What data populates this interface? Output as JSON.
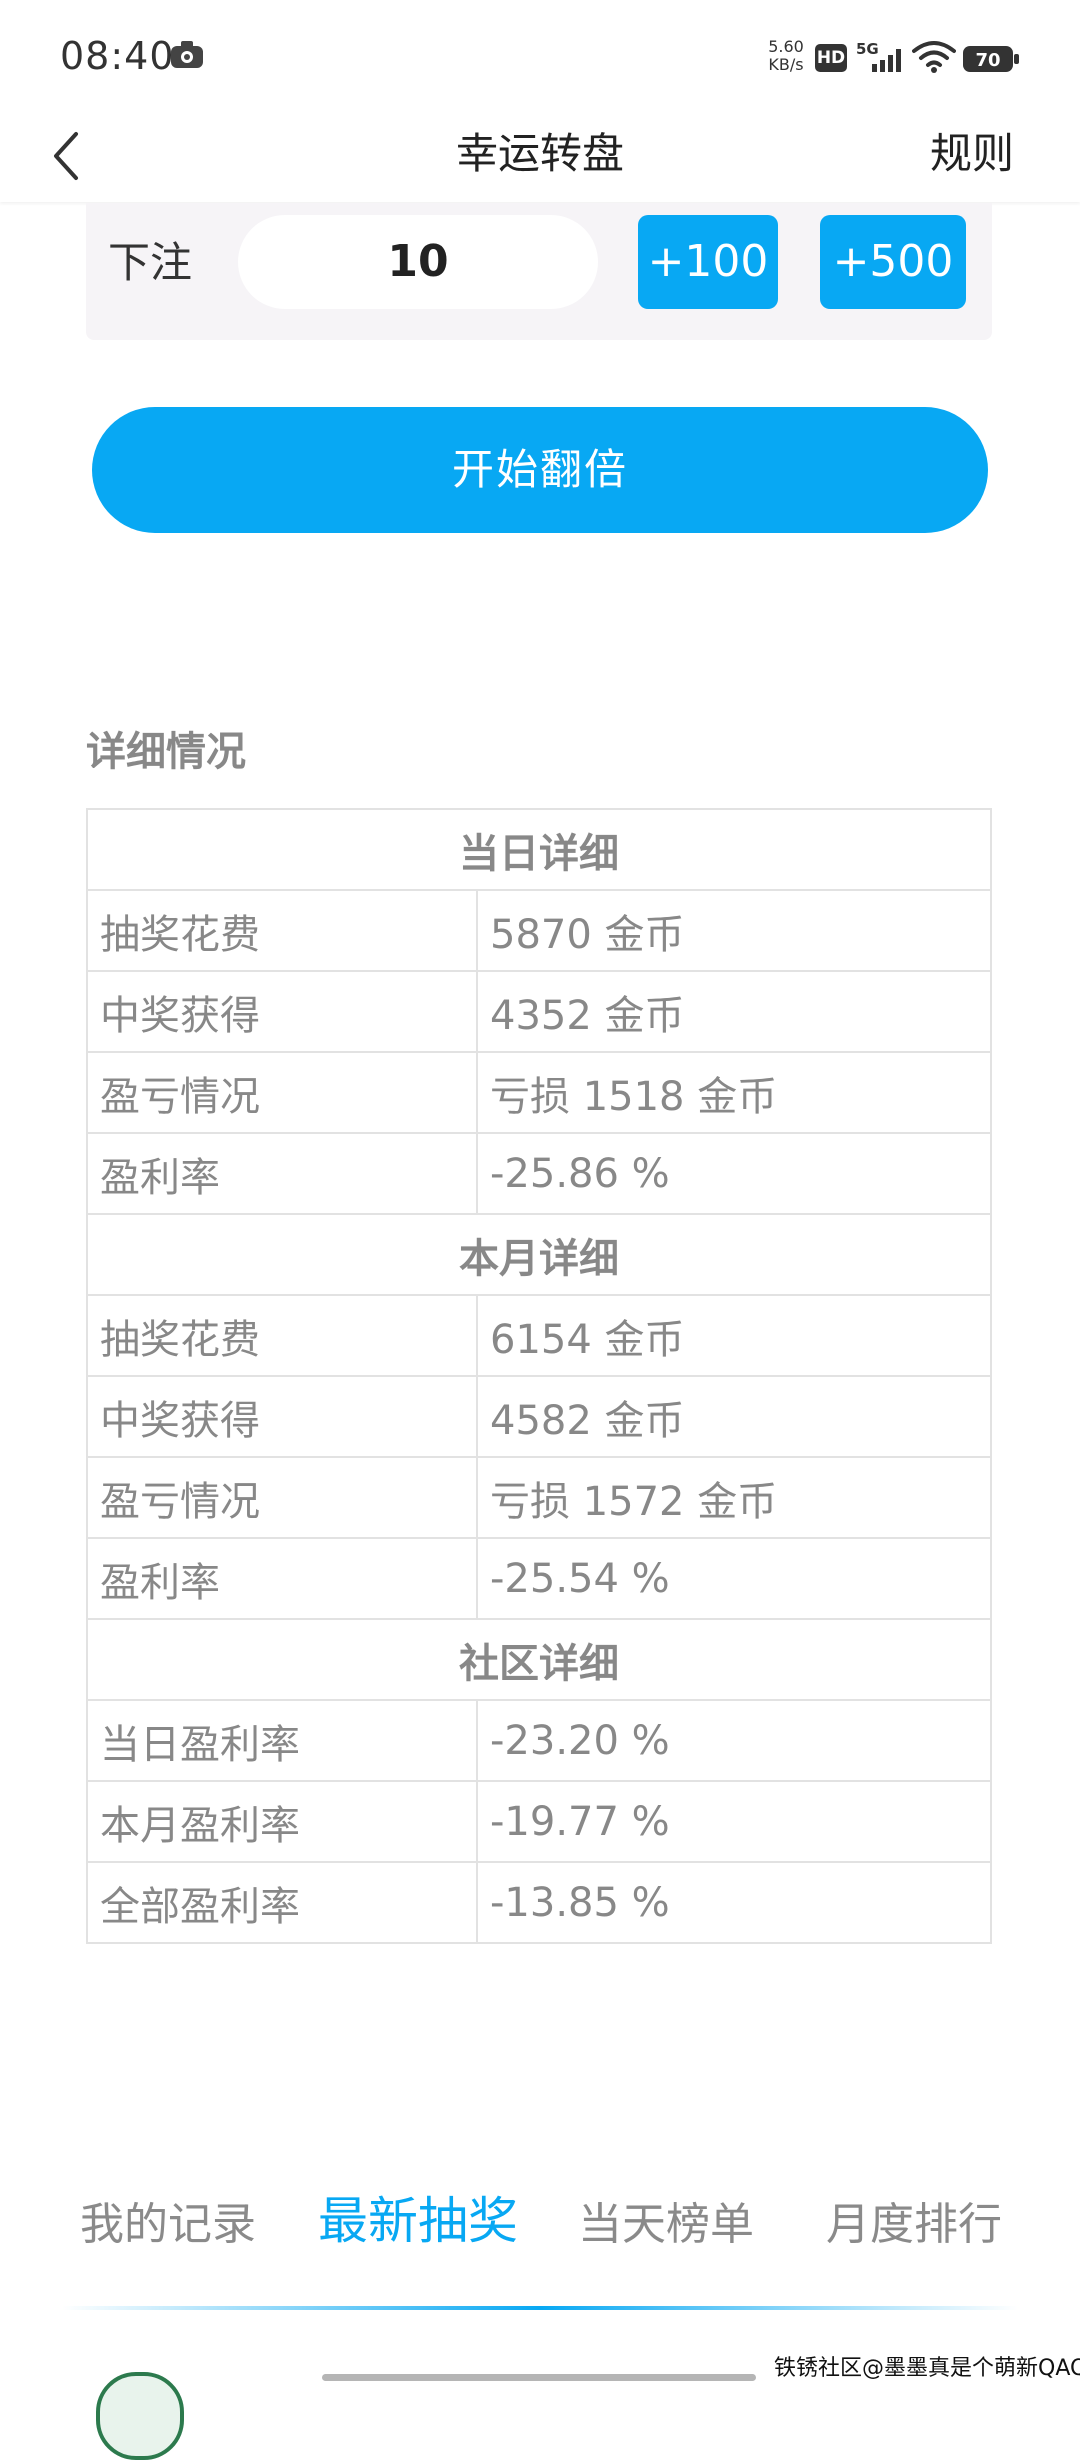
{
  "status_bar": {
    "time": "08:40",
    "net_speed_value": "5.60",
    "net_speed_unit": "KB/s",
    "hd": "HD",
    "signal": "5G",
    "battery": "70"
  },
  "nav": {
    "title": "幸运转盘",
    "rules": "规则",
    "back_icon": "chevron-left-icon"
  },
  "bet": {
    "label": "下注",
    "amount": "10",
    "plus100": "+100",
    "plus500": "+500"
  },
  "start_button": "开始翻倍",
  "details": {
    "heading": "详细情况",
    "sections": [
      {
        "title": "当日详细",
        "rows": [
          {
            "label": "抽奖花费",
            "value": "5870 金币"
          },
          {
            "label": "中奖获得",
            "value": "4352 金币"
          },
          {
            "label": "盈亏情况",
            "value": "亏损 1518 金币"
          },
          {
            "label": "盈利率",
            "value": "-25.86 %"
          }
        ]
      },
      {
        "title": "本月详细",
        "rows": [
          {
            "label": "抽奖花费",
            "value": "6154 金币"
          },
          {
            "label": "中奖获得",
            "value": "4582 金币"
          },
          {
            "label": "盈亏情况",
            "value": "亏损 1572 金币"
          },
          {
            "label": "盈利率",
            "value": "-25.54 %"
          }
        ]
      },
      {
        "title": "社区详细",
        "rows": [
          {
            "label": "当日盈利率",
            "value": "-23.20 %"
          },
          {
            "label": "本月盈利率",
            "value": "-19.77 %"
          },
          {
            "label": "全部盈利率",
            "value": "-13.85 %"
          }
        ]
      }
    ]
  },
  "tabs": [
    {
      "label": "我的记录",
      "active": false
    },
    {
      "label": "最新抽奖",
      "active": true
    },
    {
      "label": "当天榜单",
      "active": false
    },
    {
      "label": "月度排行",
      "active": false
    }
  ],
  "watermark": "铁锈社区@墨墨真是个萌新QAQ",
  "colors": {
    "accent": "#08a8f3",
    "panel_bg": "#f6f4f7",
    "muted_text": "#888888"
  }
}
